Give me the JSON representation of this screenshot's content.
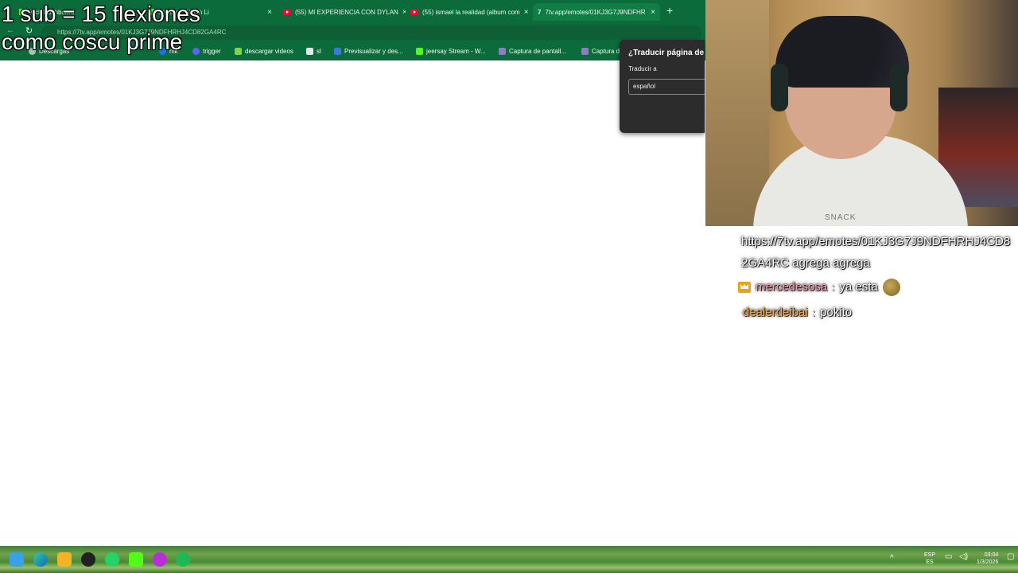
{
  "tabs": [
    {
      "label": "Kick Dashboard",
      "icon": "kick-icon",
      "active": false
    },
    {
      "label": "Stream - Watch Li",
      "icon": "kick-icon",
      "active": false
    },
    {
      "label": "(55) MI EXPERIENCIA CON DYLAN",
      "icon": "youtube-icon",
      "active": false
    },
    {
      "label": "(55) ismael la realidad (album com",
      "icon": "youtube-icon",
      "active": false
    },
    {
      "label": "7tv.app/emotes/01KJ3G7J9NDFHR",
      "icon": "7tv-icon",
      "active": true
    }
  ],
  "address": {
    "url": "https://7tv.app/emotes/01KJ3G7J9NDFHRHJ4CD82GA4RC"
  },
  "bookmarks": [
    {
      "label": "Descargas",
      "icon": "globe-icon",
      "color": "#9ec9b0"
    },
    {
      "label": "mk",
      "icon": "facebook-icon",
      "color": "#1877f2"
    },
    {
      "label": "trigger",
      "icon": "discord-icon",
      "color": "#5865f2"
    },
    {
      "label": "descargar videos",
      "icon": "download-arrow-icon",
      "color": "#7dd34a"
    },
    {
      "label": "sl",
      "icon": "app-icon",
      "color": "#e6e6e6"
    },
    {
      "label": "Previsualizar y des...",
      "icon": "rp-icon",
      "color": "#3a7bd5"
    },
    {
      "label": "jeersay Stream - W...",
      "icon": "kick-icon",
      "color": "#53fc18"
    },
    {
      "label": "Captura de pantall...",
      "icon": "feather-icon",
      "color": "#8e7cc3"
    },
    {
      "label": "Captura d",
      "icon": "feather-icon",
      "color": "#8e7cc3"
    }
  ],
  "translate_popup": {
    "title": "¿Traducir página de",
    "label": "Traducir a",
    "selected_language": "español"
  },
  "overlay": {
    "title": "1 sub = 15 flexiones",
    "subtitle": "como coscu prime"
  },
  "webcam": {
    "shirt_text": "SNACK"
  },
  "chat": {
    "line1": "https://7tv.app/emotes/01KJ3G7J9NDFHRHJ4CD82GA4RC agrega agrega",
    "messages": [
      {
        "user": "mercedesosa",
        "separator": ":",
        "text": "ya esta",
        "badge": "crown-icon",
        "emote": "emote-icon",
        "user_color": "#f4a5b4"
      },
      {
        "user": "dealerdeibai",
        "separator": ":",
        "text": "pokito",
        "user_color": "#f2b14f"
      }
    ]
  },
  "taskbar": {
    "apps": [
      "windows-start-icon",
      "edge-icon",
      "file-explorer-icon",
      "obs-icon",
      "whatsapp-icon",
      "kick-icon",
      "app-icon",
      "spotify-icon"
    ],
    "lang_line1": "ESP",
    "lang_line2": "ES",
    "time": "03:04",
    "date": "1/3/2026"
  }
}
